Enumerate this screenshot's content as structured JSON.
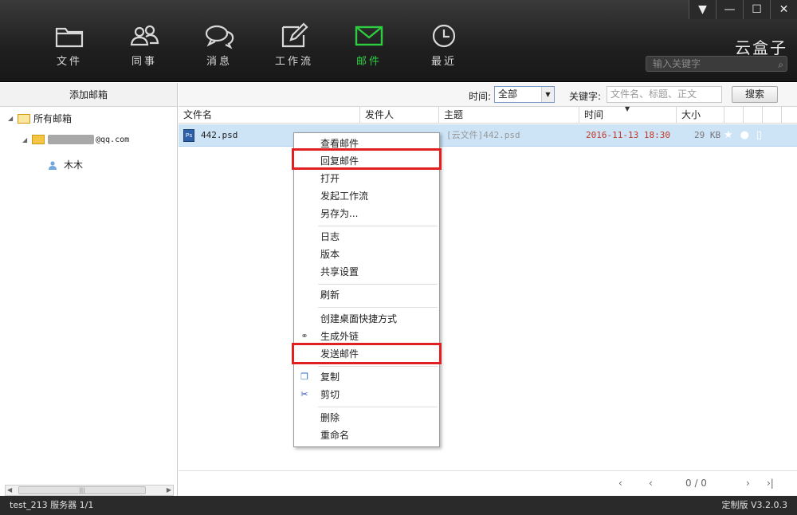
{
  "nav": {
    "items": [
      {
        "label": "文件",
        "icon": "folder-icon"
      },
      {
        "label": "同事",
        "icon": "colleagues-icon"
      },
      {
        "label": "消息",
        "icon": "message-icon"
      },
      {
        "label": "工作流",
        "icon": "workflow-edit-icon"
      },
      {
        "label": "邮件",
        "icon": "mail-icon",
        "active": true
      },
      {
        "label": "最近",
        "icon": "clock-icon"
      }
    ],
    "active_color": "#2ecc40"
  },
  "window_controls": {
    "menu": "▼",
    "minimize": "—",
    "maximize": "☐",
    "close": "✕"
  },
  "brand": "云盒子",
  "top_search_placeholder": "输入关键字",
  "left": {
    "header": "添加邮箱",
    "tree": {
      "root": "所有邮箱",
      "account_suffix": "@qq.com",
      "contact": "木木"
    },
    "scroll_grip": "|||"
  },
  "filter": {
    "time_label": "时间:",
    "time_value": "全部",
    "keyword_label": "关键字:",
    "keyword_placeholder": "文件名、标题、正文",
    "search_button": "搜索"
  },
  "table": {
    "columns": [
      "文件名",
      "发件人",
      "主题",
      "时间",
      "大小"
    ],
    "rows": [
      {
        "name": "442.psd",
        "sender": "",
        "subject": "[云文件]442.psd",
        "time": "2016-11-13 18:30",
        "size": "29 KB"
      }
    ]
  },
  "context_menu": {
    "groups": [
      [
        "查看邮件",
        "回复邮件",
        "打开",
        "发起工作流",
        "另存为..."
      ],
      [
        "日志",
        "版本",
        "共享设置"
      ],
      [
        "刷新"
      ],
      [
        "创建桌面快捷方式",
        "生成外链",
        "发送邮件"
      ],
      [
        "复制",
        "剪切"
      ],
      [
        "删除",
        "重命名"
      ]
    ],
    "highlighted": [
      "回复邮件",
      "发送邮件"
    ],
    "highlight_color": "#e02020"
  },
  "pagination": {
    "count": "0 / 0"
  },
  "status": {
    "left": "test_213  服务器 1/1",
    "right": "定制版 V3.2.0.3"
  },
  "colors": {
    "selected_row": "#cde3f6",
    "time_text": "#c0392b",
    "topbar": "#1f1f1f"
  }
}
